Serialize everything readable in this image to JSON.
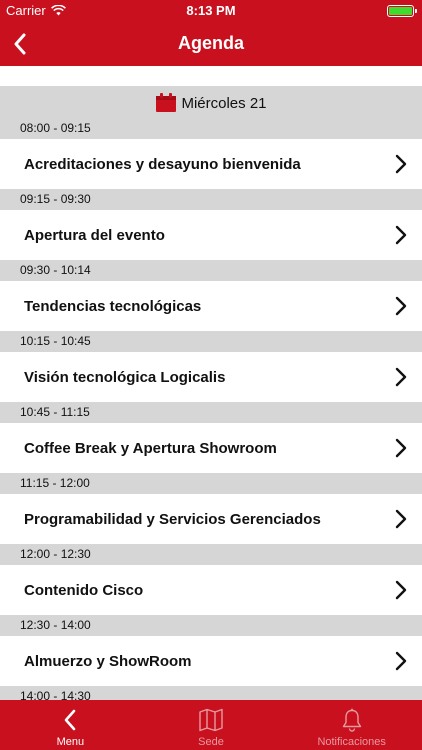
{
  "status_bar": {
    "carrier": "Carrier",
    "time": "8:13 PM"
  },
  "nav": {
    "title": "Agenda"
  },
  "day": {
    "label": "Miércoles 21"
  },
  "agenda": [
    {
      "time": "08:00 - 09:15",
      "title": "Acreditaciones y desayuno bienvenida"
    },
    {
      "time": "09:15 - 09:30",
      "title": "Apertura del evento"
    },
    {
      "time": "09:30 - 10:14",
      "title": "Tendencias tecnológicas"
    },
    {
      "time": "10:15 - 10:45",
      "title": "Visión tecnológica Logicalis"
    },
    {
      "time": "10:45 - 11:15",
      "title": "Coffee Break y Apertura Showroom"
    },
    {
      "time": "11:15 - 12:00",
      "title": "Programabilidad y Servicios Gerenciados"
    },
    {
      "time": "12:00 - 12:30",
      "title": "Contenido Cisco"
    },
    {
      "time": "12:30 - 14:00",
      "title": "Almuerzo y ShowRoom"
    },
    {
      "time": "14:00 - 14:30",
      "title": ""
    }
  ],
  "tabs": [
    {
      "label": "Menu",
      "icon": "back-arrow-icon",
      "active": true
    },
    {
      "label": "Sede",
      "icon": "map-icon",
      "active": false
    },
    {
      "label": "Notificaciones",
      "icon": "bell-icon",
      "active": false
    }
  ],
  "colors": {
    "brand": "#c8101e",
    "section_bg": "#d6d6d6",
    "battery": "#3ddc2e"
  }
}
